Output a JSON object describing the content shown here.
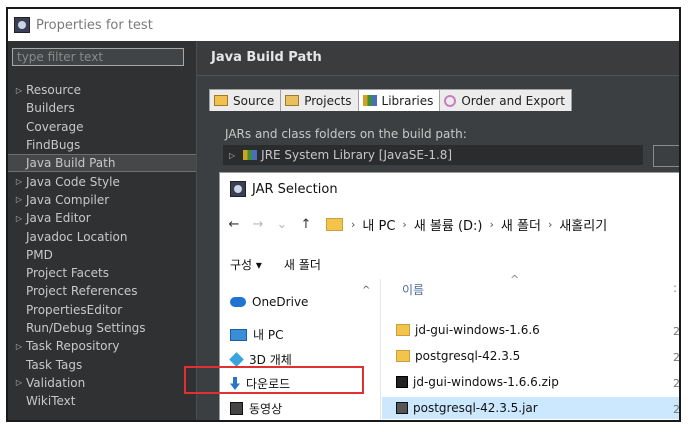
{
  "window": {
    "title": "Properties for test"
  },
  "left": {
    "filter_placeholder": "type filter text",
    "items": [
      {
        "label": "Resource",
        "expandable": true
      },
      {
        "label": "Builders",
        "expandable": false
      },
      {
        "label": "Coverage",
        "expandable": false
      },
      {
        "label": "FindBugs",
        "expandable": false
      },
      {
        "label": "Java Build Path",
        "expandable": false,
        "selected": true
      },
      {
        "label": "Java Code Style",
        "expandable": true
      },
      {
        "label": "Java Compiler",
        "expandable": true
      },
      {
        "label": "Java Editor",
        "expandable": true
      },
      {
        "label": "Javadoc Location",
        "expandable": false
      },
      {
        "label": "PMD",
        "expandable": false
      },
      {
        "label": "Project Facets",
        "expandable": false
      },
      {
        "label": "Project References",
        "expandable": false
      },
      {
        "label": "PropertiesEditor",
        "expandable": false
      },
      {
        "label": "Run/Debug Settings",
        "expandable": false
      },
      {
        "label": "Task Repository",
        "expandable": true
      },
      {
        "label": "Task Tags",
        "expandable": false
      },
      {
        "label": "Validation",
        "expandable": true
      },
      {
        "label": "WikiText",
        "expandable": false
      }
    ]
  },
  "right": {
    "title": "Java Build Path",
    "tabs": [
      {
        "label": "Source",
        "icon": "source-folder-icon"
      },
      {
        "label": "Projects",
        "icon": "projects-icon"
      },
      {
        "label": "Libraries",
        "icon": "libraries-icon",
        "active": true
      },
      {
        "label": "Order and Export",
        "icon": "order-export-icon"
      }
    ],
    "paneltext": "JARs and class folders on the build path:",
    "jre": "JRE System Library [JavaSE-1.8]"
  },
  "dialog": {
    "title": "JAR Selection",
    "breadcrumb": [
      "내 PC",
      "새 볼륨 (D:)",
      "새 폴더",
      "새홀리기"
    ],
    "toolbar": {
      "organize": "구성 ▾",
      "new_folder": "새 폴더"
    },
    "nav": [
      {
        "label": "OneDrive",
        "icon": "onedrive-icon"
      },
      {
        "label": "내 PC",
        "icon": "this-pc-icon"
      },
      {
        "label": "3D 개체",
        "icon": "3d-objects-icon"
      },
      {
        "label": "다운로드",
        "icon": "downloads-icon"
      },
      {
        "label": "동영상",
        "icon": "videos-icon"
      }
    ],
    "column": "이름",
    "files": [
      {
        "name": "jd-gui-windows-1.6.6",
        "type": "folder"
      },
      {
        "name": "postgresql-42.3.5",
        "type": "folder"
      },
      {
        "name": "jd-gui-windows-1.6.6.zip",
        "type": "zip"
      },
      {
        "name": "postgresql-42.3.5.jar",
        "type": "jar",
        "selected": true
      }
    ],
    "colors": {
      "selection": "#cce8ff",
      "highlight": "#e03030"
    }
  }
}
